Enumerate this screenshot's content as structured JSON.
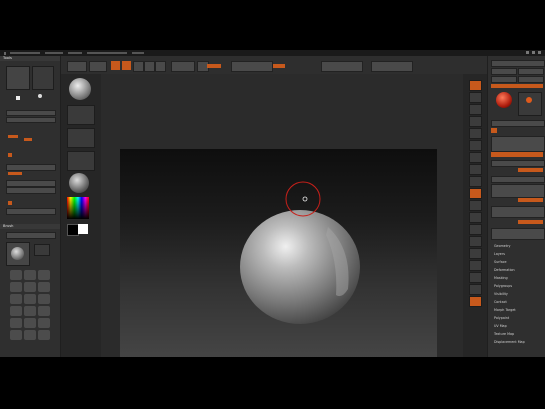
{
  "left_panel": {
    "title": "Tools",
    "brush_title": "Brush"
  },
  "right_panel": {
    "items": [
      "Geometry",
      "Layers",
      "Surface",
      "Deformation",
      "Masking",
      "Polygroups",
      "Visibility",
      "Contact",
      "Morph Target",
      "Polypaint",
      "UV Map",
      "Texture Map",
      "Displacement Map"
    ]
  },
  "colors": {
    "accent": "#c7591c",
    "background": "#2b2b2b"
  }
}
